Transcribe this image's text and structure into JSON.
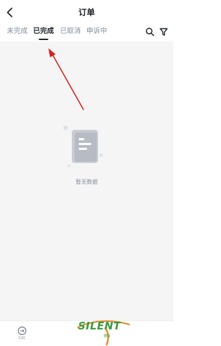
{
  "header": {
    "title": "订单"
  },
  "tabs": [
    {
      "label": "未完成",
      "active": false
    },
    {
      "label": "已完成",
      "active": true
    },
    {
      "label": "已取消",
      "active": false
    },
    {
      "label": "申诉中",
      "active": false
    }
  ],
  "empty_state": {
    "message": "暂无数据"
  },
  "bottom_bar": {
    "c2c_label": "C2C"
  },
  "watermark": {
    "brand": "SILENT",
    "sub": "德哥"
  },
  "colors": {
    "text_primary": "#1e2329",
    "text_secondary": "#848e9c",
    "background": "#f5f5f5",
    "annotation_arrow": "#d62020",
    "watermark_green": "#3b9b3b",
    "watermark_orange": "#e08a2b"
  },
  "icons": {
    "back": "chevron-left",
    "search": "magnifier",
    "filter": "funnel",
    "empty": "document",
    "c2c": "c2c-circle"
  }
}
